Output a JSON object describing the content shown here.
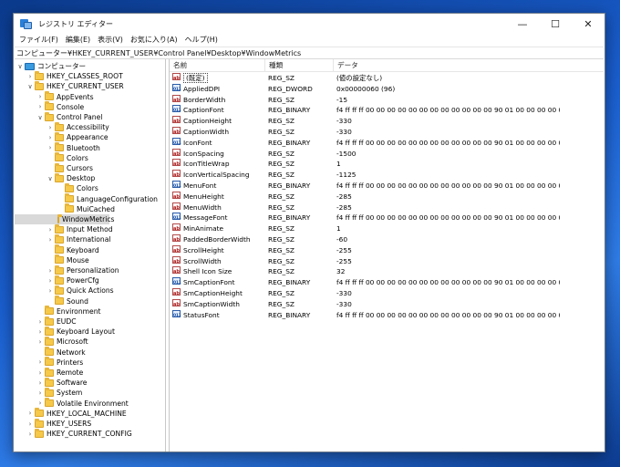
{
  "window": {
    "title": "レジストリ エディター",
    "controls": {
      "minimize": "—",
      "maximize": "☐",
      "close": "✕"
    }
  },
  "menu": [
    "ファイル(F)",
    "編集(E)",
    "表示(V)",
    "お気に入り(A)",
    "ヘルプ(H)"
  ],
  "address": "コンピューター¥HKEY_CURRENT_USER¥Control Panel¥Desktop¥WindowMetrics",
  "tree": [
    {
      "label": "コンピューター",
      "depth": 0,
      "chev": "∨",
      "icon": "computer-icon"
    },
    {
      "label": "HKEY_CLASSES_ROOT",
      "depth": 1,
      "chev": "›",
      "icon": "folder-icon"
    },
    {
      "label": "HKEY_CURRENT_USER",
      "depth": 1,
      "chev": "∨",
      "icon": "folder-icon"
    },
    {
      "label": "AppEvents",
      "depth": 2,
      "chev": "›",
      "icon": "folder-icon"
    },
    {
      "label": "Console",
      "depth": 2,
      "chev": "›",
      "icon": "folder-icon"
    },
    {
      "label": "Control Panel",
      "depth": 2,
      "chev": "∨",
      "icon": "folder-icon"
    },
    {
      "label": "Accessibility",
      "depth": 3,
      "chev": "›",
      "icon": "folder-icon"
    },
    {
      "label": "Appearance",
      "depth": 3,
      "chev": "›",
      "icon": "folder-icon"
    },
    {
      "label": "Bluetooth",
      "depth": 3,
      "chev": "›",
      "icon": "folder-icon"
    },
    {
      "label": "Colors",
      "depth": 3,
      "chev": "",
      "icon": "folder-icon"
    },
    {
      "label": "Cursors",
      "depth": 3,
      "chev": "",
      "icon": "folder-icon"
    },
    {
      "label": "Desktop",
      "depth": 3,
      "chev": "∨",
      "icon": "folder-icon"
    },
    {
      "label": "Colors",
      "depth": 4,
      "chev": "",
      "icon": "folder-icon"
    },
    {
      "label": "LanguageConfiguration",
      "depth": 4,
      "chev": "",
      "icon": "folder-icon"
    },
    {
      "label": "MuiCached",
      "depth": 4,
      "chev": "",
      "icon": "folder-icon"
    },
    {
      "label": "WindowMetrics",
      "depth": 4,
      "chev": "",
      "icon": "folder-icon",
      "selected": true
    },
    {
      "label": "Input Method",
      "depth": 3,
      "chev": "›",
      "icon": "folder-icon"
    },
    {
      "label": "International",
      "depth": 3,
      "chev": "›",
      "icon": "folder-icon"
    },
    {
      "label": "Keyboard",
      "depth": 3,
      "chev": "",
      "icon": "folder-icon"
    },
    {
      "label": "Mouse",
      "depth": 3,
      "chev": "",
      "icon": "folder-icon"
    },
    {
      "label": "Personalization",
      "depth": 3,
      "chev": "›",
      "icon": "folder-icon"
    },
    {
      "label": "PowerCfg",
      "depth": 3,
      "chev": "›",
      "icon": "folder-icon"
    },
    {
      "label": "Quick Actions",
      "depth": 3,
      "chev": "›",
      "icon": "folder-icon"
    },
    {
      "label": "Sound",
      "depth": 3,
      "chev": "",
      "icon": "folder-icon"
    },
    {
      "label": "Environment",
      "depth": 2,
      "chev": "",
      "icon": "folder-icon"
    },
    {
      "label": "EUDC",
      "depth": 2,
      "chev": "›",
      "icon": "folder-icon"
    },
    {
      "label": "Keyboard Layout",
      "depth": 2,
      "chev": "›",
      "icon": "folder-icon"
    },
    {
      "label": "Microsoft",
      "depth": 2,
      "chev": "›",
      "icon": "folder-icon"
    },
    {
      "label": "Network",
      "depth": 2,
      "chev": "",
      "icon": "folder-icon"
    },
    {
      "label": "Printers",
      "depth": 2,
      "chev": "›",
      "icon": "folder-icon"
    },
    {
      "label": "Remote",
      "depth": 2,
      "chev": "›",
      "icon": "folder-icon"
    },
    {
      "label": "Software",
      "depth": 2,
      "chev": "›",
      "icon": "folder-icon"
    },
    {
      "label": "System",
      "depth": 2,
      "chev": "›",
      "icon": "folder-icon"
    },
    {
      "label": "Volatile Environment",
      "depth": 2,
      "chev": "›",
      "icon": "folder-icon"
    },
    {
      "label": "HKEY_LOCAL_MACHINE",
      "depth": 1,
      "chev": "›",
      "icon": "folder-icon"
    },
    {
      "label": "HKEY_USERS",
      "depth": 1,
      "chev": "›",
      "icon": "folder-icon"
    },
    {
      "label": "HKEY_CURRENT_CONFIG",
      "depth": 1,
      "chev": "›",
      "icon": "folder-icon"
    }
  ],
  "columns": {
    "name": "名前",
    "type": "種類",
    "data": "データ"
  },
  "values": [
    {
      "name": "(既定)",
      "type": "REG_SZ",
      "data": "(値の設定なし)",
      "icon": "string-value-icon",
      "is_default": true
    },
    {
      "name": "AppliedDPI",
      "type": "REG_DWORD",
      "data": "0x00000060 (96)",
      "icon": "binary-value-icon"
    },
    {
      "name": "BorderWidth",
      "type": "REG_SZ",
      "data": "-15",
      "icon": "string-value-icon"
    },
    {
      "name": "CaptionFont",
      "type": "REG_BINARY",
      "data": "f4 ff ff ff 00 00 00 00 00 00 00 00 00 00 00 00 90 01 00 00 00 00 00 01 00 00 0...",
      "icon": "binary-value-icon"
    },
    {
      "name": "CaptionHeight",
      "type": "REG_SZ",
      "data": "-330",
      "icon": "string-value-icon"
    },
    {
      "name": "CaptionWidth",
      "type": "REG_SZ",
      "data": "-330",
      "icon": "string-value-icon"
    },
    {
      "name": "IconFont",
      "type": "REG_BINARY",
      "data": "f4 ff ff ff 00 00 00 00 00 00 00 00 00 00 00 00 90 01 00 00 00 00 00 01 00 00 0...",
      "icon": "binary-value-icon"
    },
    {
      "name": "IconSpacing",
      "type": "REG_SZ",
      "data": "-1500",
      "icon": "string-value-icon"
    },
    {
      "name": "IconTitleWrap",
      "type": "REG_SZ",
      "data": "1",
      "icon": "string-value-icon"
    },
    {
      "name": "IconVerticalSpacing",
      "type": "REG_SZ",
      "data": "-1125",
      "icon": "string-value-icon"
    },
    {
      "name": "MenuFont",
      "type": "REG_BINARY",
      "data": "f4 ff ff ff 00 00 00 00 00 00 00 00 00 00 00 00 90 01 00 00 00 00 00 01 00 00 0...",
      "icon": "binary-value-icon"
    },
    {
      "name": "MenuHeight",
      "type": "REG_SZ",
      "data": "-285",
      "icon": "string-value-icon"
    },
    {
      "name": "MenuWidth",
      "type": "REG_SZ",
      "data": "-285",
      "icon": "string-value-icon"
    },
    {
      "name": "MessageFont",
      "type": "REG_BINARY",
      "data": "f4 ff ff ff 00 00 00 00 00 00 00 00 00 00 00 00 90 01 00 00 00 00 00 01 00 00 0...",
      "icon": "binary-value-icon"
    },
    {
      "name": "MinAnimate",
      "type": "REG_SZ",
      "data": "1",
      "icon": "string-value-icon"
    },
    {
      "name": "PaddedBorderWidth",
      "type": "REG_SZ",
      "data": "-60",
      "icon": "string-value-icon"
    },
    {
      "name": "ScrollHeight",
      "type": "REG_SZ",
      "data": "-255",
      "icon": "string-value-icon"
    },
    {
      "name": "ScrollWidth",
      "type": "REG_SZ",
      "data": "-255",
      "icon": "string-value-icon"
    },
    {
      "name": "Shell Icon Size",
      "type": "REG_SZ",
      "data": "32",
      "icon": "string-value-icon"
    },
    {
      "name": "SmCaptionFont",
      "type": "REG_BINARY",
      "data": "f4 ff ff ff 00 00 00 00 00 00 00 00 00 00 00 00 90 01 00 00 00 00 00 01 00 00 0...",
      "icon": "binary-value-icon"
    },
    {
      "name": "SmCaptionHeight",
      "type": "REG_SZ",
      "data": "-330",
      "icon": "string-value-icon"
    },
    {
      "name": "SmCaptionWidth",
      "type": "REG_SZ",
      "data": "-330",
      "icon": "string-value-icon"
    },
    {
      "name": "StatusFont",
      "type": "REG_BINARY",
      "data": "f4 ff ff ff 00 00 00 00 00 00 00 00 00 00 00 00 90 01 00 00 00 00 00 01 00 00 0...",
      "icon": "binary-value-icon"
    }
  ]
}
